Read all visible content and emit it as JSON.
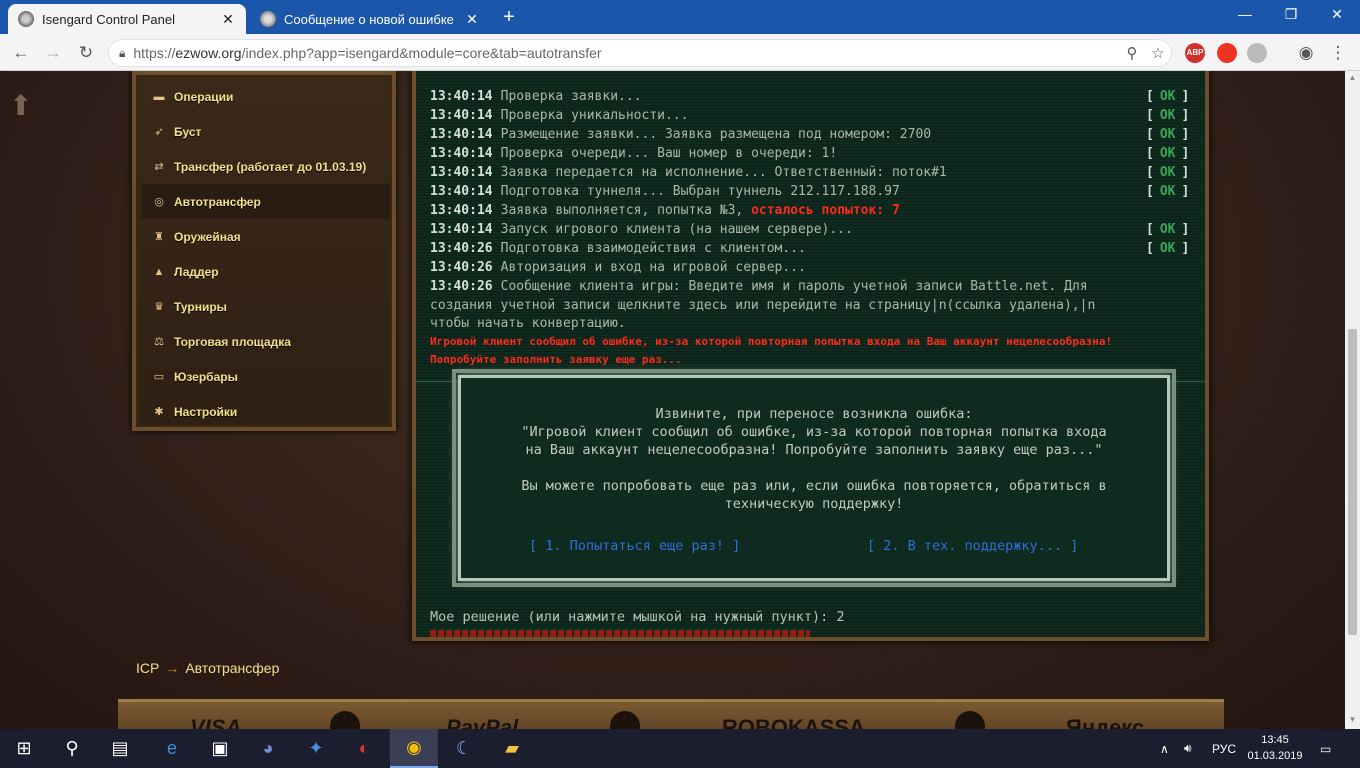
{
  "browser": {
    "tabs": [
      {
        "title": "Isengard Control Panel",
        "active": true
      },
      {
        "title": "Сообщение о новой ошибке",
        "active": false
      }
    ],
    "url_prefix": "https://",
    "url_host": "ezwow.org",
    "url_path": "/index.php?app=isengard&module=core&tab=autotransfer",
    "extensions": [
      "ABP"
    ]
  },
  "sidebar": {
    "items": [
      {
        "label": "Операции",
        "icon": "operations-icon",
        "glyph": "▬"
      },
      {
        "label": "Буст",
        "icon": "rocket-icon",
        "glyph": "➶"
      },
      {
        "label": "Трансфер (работает до 01.03.19)",
        "icon": "transfer-icon",
        "glyph": "⇄"
      },
      {
        "label": "Автотрансфер",
        "icon": "autotransfer-icon",
        "glyph": "◎",
        "active": true
      },
      {
        "label": "Оружейная",
        "icon": "armory-icon",
        "glyph": "♜"
      },
      {
        "label": "Ладдер",
        "icon": "ladder-icon",
        "glyph": "▲"
      },
      {
        "label": "Турниры",
        "icon": "trophy-icon",
        "glyph": "♛"
      },
      {
        "label": "Торговая площадка",
        "icon": "scales-icon",
        "glyph": "⚖"
      },
      {
        "label": "Юзербары",
        "icon": "userbar-icon",
        "glyph": "▭"
      },
      {
        "label": "Настройки",
        "icon": "gear-icon",
        "glyph": "✱"
      }
    ]
  },
  "console": {
    "lines": [
      {
        "time": "13:40:14",
        "text": "Проверка заявки...",
        "ok": true
      },
      {
        "time": "13:40:14",
        "text": "Проверка уникальности...",
        "ok": true
      },
      {
        "time": "13:40:14",
        "text": "Размещение заявки... Заявка размещена под номером: 2700",
        "ok": true
      },
      {
        "time": "13:40:14",
        "text": "Проверка очереди... Ваш номер в очереди: 1!",
        "ok": true
      },
      {
        "time": "13:40:14",
        "text": "Заявка передается на исполнение... Ответственный: поток#1",
        "ok": true
      },
      {
        "time": "13:40:14",
        "text": "Подготовка туннеля... Выбран туннель 212.117.188.97",
        "ok": true
      },
      {
        "time": "13:40:14",
        "text": "Заявка выполняется, попытка №3, ",
        "warn": "осталось попыток: 7",
        "ok": false
      },
      {
        "time": "13:40:14",
        "text": "Запуск игрового клиента (на нашем сервере)...",
        "ok": true
      },
      {
        "time": "13:40:26",
        "text": "Подготовка взаимодействия с клиентом...",
        "ok": true
      },
      {
        "time": "13:40:26",
        "text": "Авторизация и вход на игровой сервер...",
        "ok": false
      },
      {
        "time": "13:40:26",
        "text": "Сообщение клиента игры: Введите имя и пароль учетной записи Battle.net. Для",
        "ok": false
      }
    ],
    "continuation": [
      "создания учетной записи щелкните здесь или перейдите на страницу|n(ссылка удалена),|n",
      "чтобы начать конвертацию."
    ],
    "ok_label": "OK",
    "error_lines": [
      "Игровой клиент сообщил об ошибке, из-за которой повторная попытка входа на Ваш аккаунт нецелесообразна!",
      "Попробуйте заполнить заявку еще раз..."
    ],
    "error_box": {
      "line1": "Извините, при переносе возникла ошибка:",
      "line2": "\"Игровой клиент сообщил об ошибке, из-за которой повторная попытка входа",
      "line3": "на Ваш аккаунт нецелесообразна! Попробуйте заполнить заявку еще раз...\"",
      "line4": "Вы можете попробовать еще раз или, если ошибка повторяется, обратиться в",
      "line5": "техническую поддержку!",
      "option1": "[ 1. Попытаться еще раз! ]",
      "option2": "[ 2. В тех. поддержку... ]"
    },
    "decision": "Мое решение (или нажмите мышкой на нужный пункт): 2"
  },
  "breadcrumb": {
    "root": "ICP",
    "sep": "→",
    "current": "Автотрансфер"
  },
  "footer": {
    "payments": [
      "VISA",
      "PayPal",
      "ROBOKASSA",
      "Яндекс"
    ]
  },
  "taskbar": {
    "lang": "РУС",
    "time": "13:45",
    "date": "01.03.2019"
  }
}
